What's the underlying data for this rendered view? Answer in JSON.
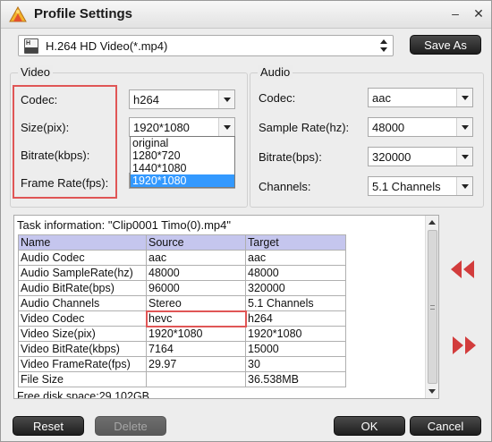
{
  "window": {
    "title": "Profile Settings",
    "controls": {
      "minimize": "–",
      "close": "✕"
    }
  },
  "profile": {
    "icon_label": "H",
    "selected": "H.264 HD Video(*.mp4)",
    "save_as_label": "Save As"
  },
  "video": {
    "group_title": "Video",
    "codec_label": "Codec:",
    "codec_value": "h264",
    "size_label": "Size(pix):",
    "size_value": "1920*1080",
    "bitrate_label": "Bitrate(kbps):",
    "framerate_label": "Frame Rate(fps):",
    "size_options": [
      "original",
      "1280*720",
      "1440*1080",
      "1920*1080"
    ]
  },
  "audio": {
    "group_title": "Audio",
    "codec_label": "Codec:",
    "codec_value": "aac",
    "samplerate_label": "Sample Rate(hz):",
    "samplerate_value": "48000",
    "bitrate_label": "Bitrate(bps):",
    "bitrate_value": "320000",
    "channels_label": "Channels:",
    "channels_value": "5.1 Channels"
  },
  "task_info": {
    "title": "Task information: \"Clip0001 Timo(0).mp4\"",
    "headers": [
      "Name",
      "Source",
      "Target"
    ],
    "rows": [
      [
        "Audio Codec",
        "aac",
        "aac"
      ],
      [
        "Audio SampleRate(hz)",
        "48000",
        "48000"
      ],
      [
        "Audio BitRate(bps)",
        "96000",
        "320000"
      ],
      [
        "Audio Channels",
        "Stereo",
        "5.1 Channels"
      ],
      [
        "Video Codec",
        "hevc",
        "h264"
      ],
      [
        "Video Size(pix)",
        "1920*1080",
        "1920*1080"
      ],
      [
        "Video BitRate(kbps)",
        "7164",
        "15000"
      ],
      [
        "Video FrameRate(fps)",
        "29.97",
        "30"
      ],
      [
        "File Size",
        "",
        "36.538MB"
      ]
    ],
    "free_disk": "Free disk space:29.102GB"
  },
  "buttons": {
    "reset": "Reset",
    "delete": "Delete",
    "ok": "OK",
    "cancel": "Cancel"
  },
  "colors": {
    "highlight_red": "#e05656",
    "nav_arrow_red": "#d23c3c",
    "table_header": "#c5c6ee",
    "selection_blue": "#3399ff"
  },
  "icons": {
    "app": "profile-settings-app-icon",
    "prev": "double-left-arrow-icon",
    "next": "double-right-arrow-icon"
  }
}
